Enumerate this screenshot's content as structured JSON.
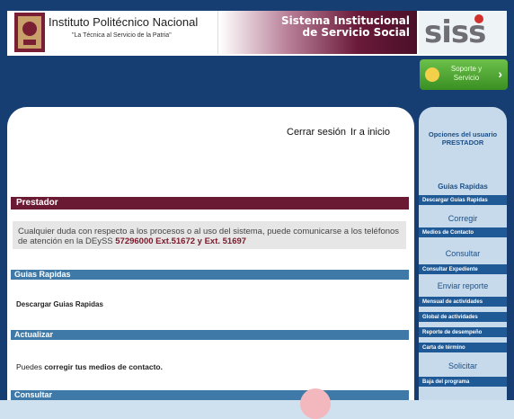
{
  "header": {
    "institution_name": "Instituto Politécnico Nacional",
    "institution_motto": "\"La Técnica al Servicio de la Patria\"",
    "system_title_line1": "Sistema Institucional",
    "system_title_line2": "de Servicio Social",
    "siss_logo_text": "siss",
    "support_button_line1": "Soporte y",
    "support_button_line2": "Servicio"
  },
  "topnav": {
    "logout": "Cerrar sesión",
    "home": "Ir a inicio"
  },
  "main": {
    "prestador_title": "Prestador",
    "notice_text_1": "Cualquier duda con respecto a los procesos o al uso del sistema, puede comunicarse a los teléfonos de atención en la DEySS ",
    "notice_phone": "57296000 Ext.51672 y Ext. 51697",
    "sections": {
      "guias": "Guias Rapidas",
      "actualizar": "Actualizar",
      "consultar": "Consultar"
    },
    "download_guides": "Descargar Guias Rapidas",
    "update_prefix": "Puedes ",
    "update_link": "corregir tus medios de contacto."
  },
  "sidebar": {
    "title": "Opciones del usuario PRESTADOR",
    "groups": [
      {
        "label": "Guias Rapidas",
        "items": [
          "Descargar Guias Rapidas"
        ]
      },
      {
        "label": "Corregir",
        "items": [
          "Medios de Contacto"
        ]
      },
      {
        "label": "Consultar",
        "items": [
          "Consultar Expediente"
        ]
      },
      {
        "label": "Enviar reporte",
        "items": [
          "Mensual de actividades",
          "Global de actividades",
          "Reporte de desempeño",
          "Carta de término"
        ]
      },
      {
        "label": "Solicitar",
        "items": [
          "Baja del programa"
        ]
      }
    ]
  },
  "colors": {
    "banner_blue": "#163e73",
    "prestador_bar": "#6b1a34",
    "section_bar": "#3f79a8",
    "sidebar_bg": "#c6daeb",
    "sidebar_item": "#1f5a97"
  }
}
